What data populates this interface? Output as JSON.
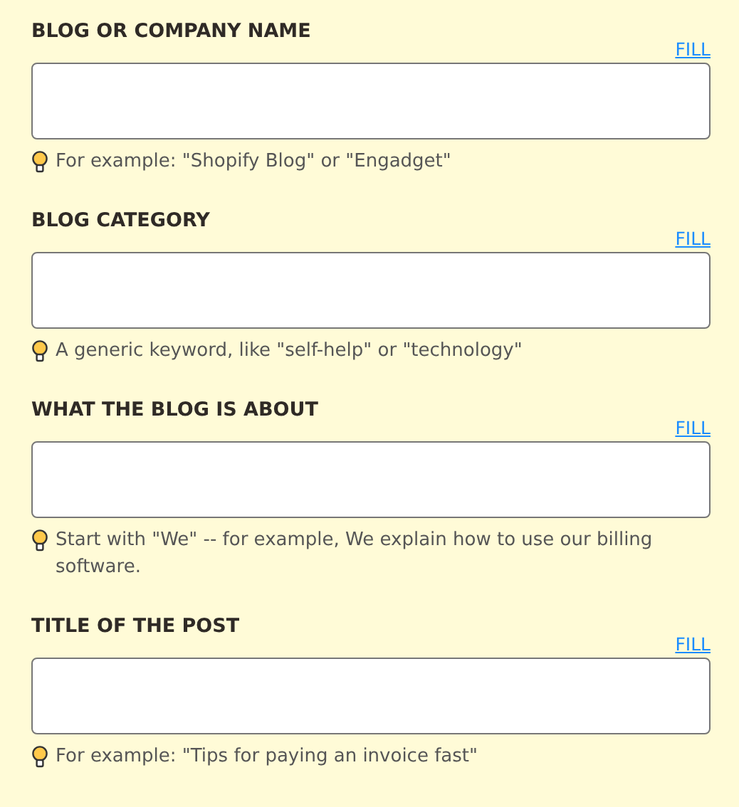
{
  "fields": [
    {
      "label": "BLOG OR COMPANY NAME",
      "fill": "FILL",
      "hint": "For example: \"Shopify Blog\" or \"Engadget\""
    },
    {
      "label": "BLOG CATEGORY",
      "fill": "FILL",
      "hint": "A generic keyword, like \"self-help\" or \"technology\""
    },
    {
      "label": "WHAT THE BLOG IS ABOUT",
      "fill": "FILL",
      "hint": "Start with \"We\" -- for example, We explain how to use our billing software."
    },
    {
      "label": "TITLE OF THE POST",
      "fill": "FILL",
      "hint": "For example: \"Tips for paying an invoice fast\""
    }
  ]
}
